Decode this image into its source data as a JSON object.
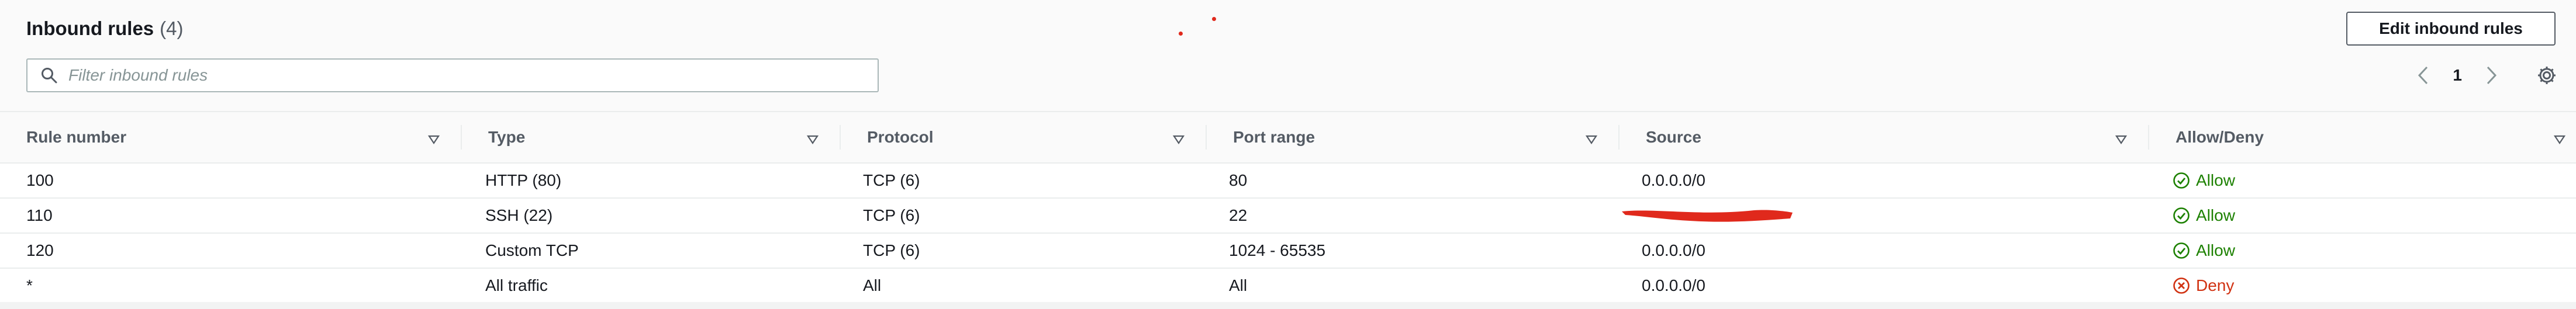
{
  "header": {
    "title": "Inbound rules",
    "count": "(4)",
    "edit_button": "Edit inbound rules"
  },
  "filter": {
    "placeholder": "Filter inbound rules",
    "value": ""
  },
  "pagination": {
    "current_page": "1"
  },
  "table": {
    "columns": [
      "Rule number",
      "Type",
      "Protocol",
      "Port range",
      "Source",
      "Allow/Deny"
    ],
    "rows": [
      {
        "rule_number": "100",
        "type": "HTTP (80)",
        "protocol": "TCP (6)",
        "port_range": "80",
        "source": "0.0.0.0/0",
        "action": "Allow"
      },
      {
        "rule_number": "110",
        "type": "SSH (22)",
        "protocol": "TCP (6)",
        "port_range": "22",
        "source": "",
        "action": "Allow"
      },
      {
        "rule_number": "120",
        "type": "Custom TCP",
        "protocol": "TCP (6)",
        "port_range": "1024 - 65535",
        "source": "0.0.0.0/0",
        "action": "Allow"
      },
      {
        "rule_number": "*",
        "type": "All traffic",
        "protocol": "All",
        "port_range": "All",
        "source": "0.0.0.0/0",
        "action": "Deny"
      }
    ]
  },
  "colors": {
    "allow": "#1d8102",
    "deny": "#d13212",
    "redaction": "#e0291c"
  },
  "icons": {
    "search": "search-icon",
    "prev": "chevron-left-icon",
    "next": "chevron-right-icon",
    "settings": "gear-icon",
    "sort": "sort-caret-icon",
    "allow": "check-circle-icon",
    "deny": "x-circle-icon"
  }
}
